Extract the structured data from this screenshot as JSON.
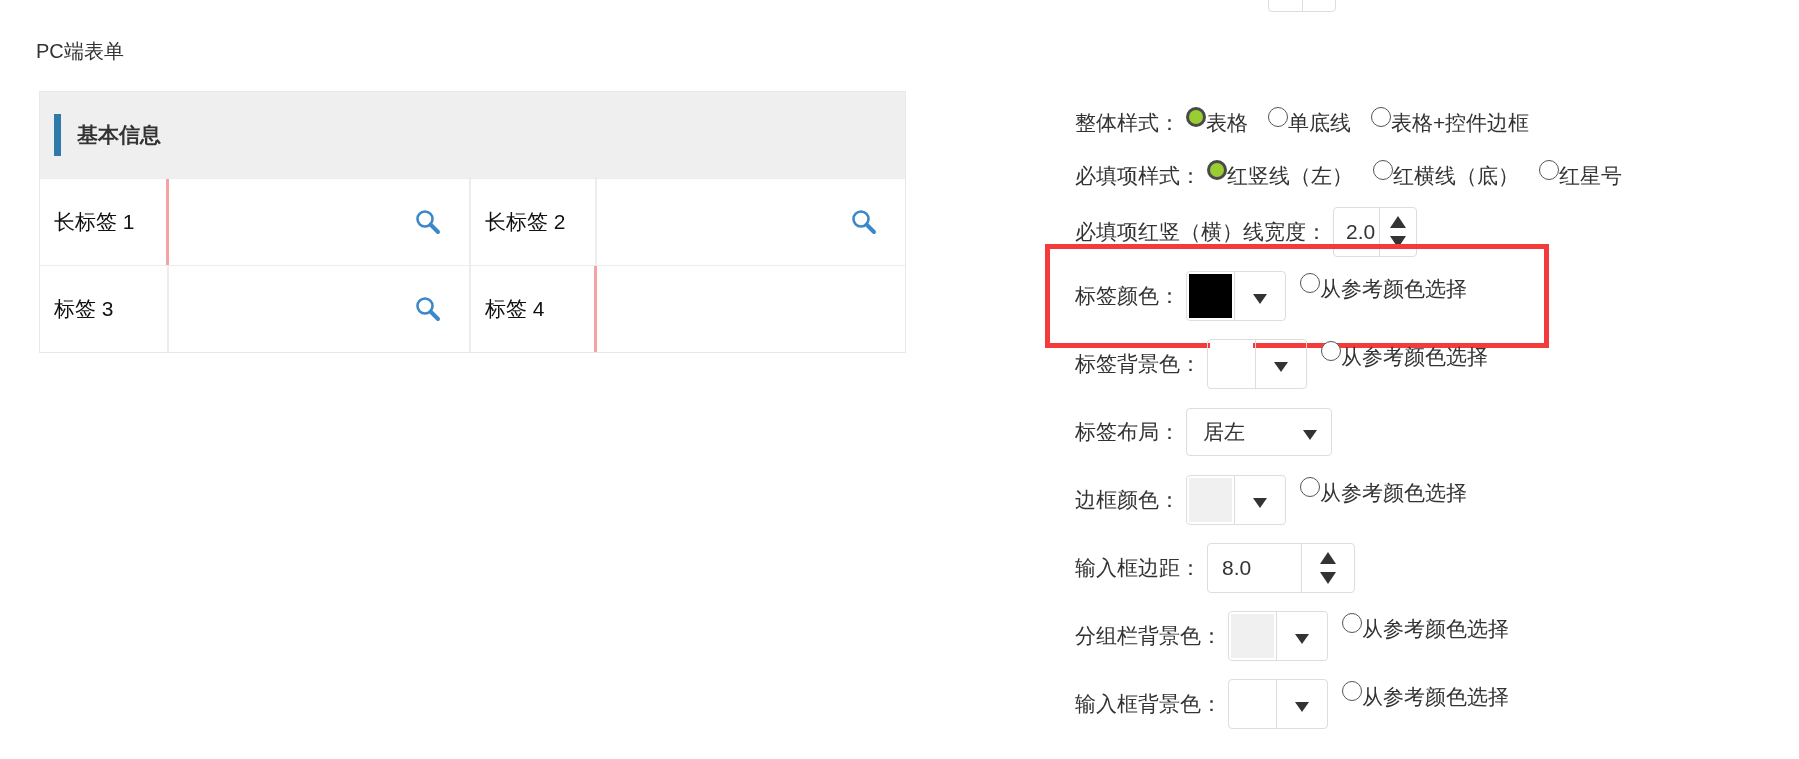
{
  "title": "PC端表单",
  "form": {
    "section_title": "基本信息",
    "rows": [
      [
        {
          "label": "长标签 1",
          "required": true,
          "lookup": true
        },
        {
          "label": "长标签 2",
          "required": false,
          "lookup": true
        }
      ],
      [
        {
          "label": "标签 3",
          "required": false,
          "lookup": true
        },
        {
          "label": "标签 4",
          "required": true,
          "lookup": false
        }
      ]
    ]
  },
  "settings": [
    {
      "kind": "radio",
      "label": "整体样式：",
      "options": [
        {
          "label": "表格",
          "selected": true
        },
        {
          "label": "单底线",
          "selected": false
        },
        {
          "label": "表格+控件边框",
          "selected": false
        }
      ]
    },
    {
      "kind": "radio",
      "label": "必填项样式：",
      "options": [
        {
          "label": "红竖线（左）",
          "selected": true
        },
        {
          "label": "红横线（底）",
          "selected": false
        },
        {
          "label": "红星号",
          "selected": false
        }
      ]
    },
    {
      "kind": "spinner",
      "label": "必填项红竖（横）线宽度：",
      "value": "2.0",
      "narrow": true
    },
    {
      "kind": "color",
      "label": "标签颜色：",
      "color": "#000000",
      "option": "从参考颜色选择",
      "option_selected": false,
      "highlighted": true
    },
    {
      "kind": "color",
      "label": "标签背景色：",
      "color": "#ffffff",
      "option": "从参考颜色选择",
      "option_selected": false,
      "highlighted": false
    },
    {
      "kind": "select",
      "label": "标签布局：",
      "value": "居左"
    },
    {
      "kind": "color",
      "label": "边框颜色：",
      "color": "#f0f0f0",
      "option": "从参考颜色选择",
      "option_selected": false,
      "highlighted": false
    },
    {
      "kind": "spinner",
      "label": "输入框边距：",
      "value": "8.0",
      "narrow": false
    },
    {
      "kind": "color",
      "label": "分组栏背景色：",
      "color": "#f0f0f0",
      "option": "从参考颜色选择",
      "option_selected": false,
      "highlighted": false
    },
    {
      "kind": "color",
      "label": "输入框背景色：",
      "color": "#ffffff",
      "option": "从参考颜色选择",
      "option_selected": false,
      "highlighted": false
    }
  ]
}
